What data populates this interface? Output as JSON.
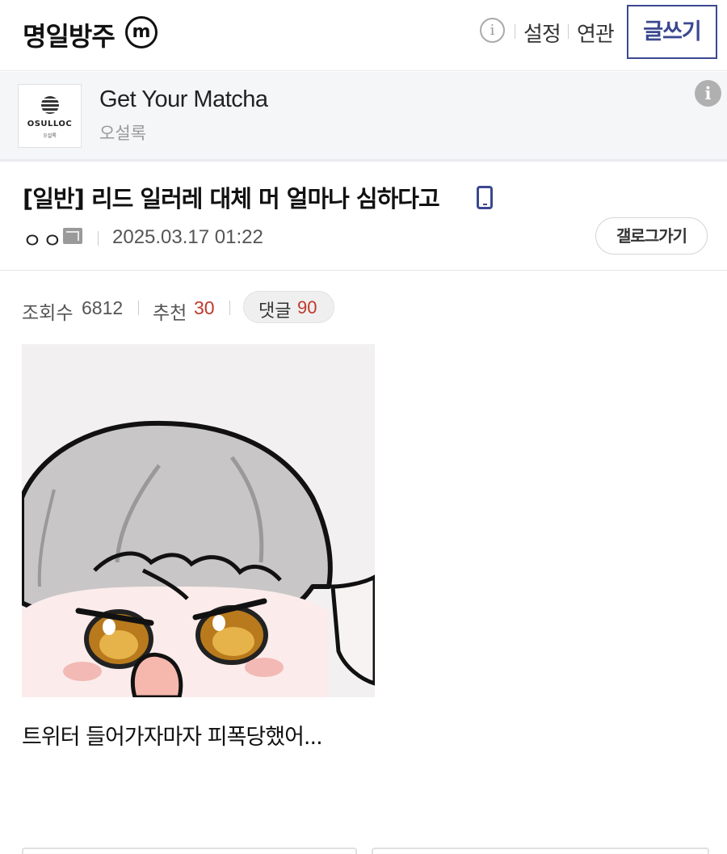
{
  "header": {
    "gallery_title": "명일방주",
    "minor_badge": "m",
    "info_icon": "i",
    "settings_label": "설정",
    "related_label": "연관",
    "write_label": "글쓰기"
  },
  "ad": {
    "logo_text": "OSULLOC",
    "logo_subtext": "오설록",
    "title": "Get Your Matcha",
    "brand": "오설록",
    "info_icon": "i"
  },
  "post": {
    "title": "[일반] 리드 일러레 대체 머 얼마나 심하다고",
    "author": "ㅇㅇ",
    "date": "2025.03.17 01:22",
    "gallog_label": "갤로그가기",
    "stats": {
      "views_label": "조회수",
      "views": "6812",
      "recommend_label": "추천",
      "recommend": "30",
      "comments_label": "댓글",
      "comments": "90"
    },
    "body_text": "트위터 들어가자마자 피폭당했어..."
  },
  "colors": {
    "accent": "#3b4890",
    "count_red": "#c0392b"
  },
  "icons": {
    "minor_gallery": "minor-gallery-icon",
    "info": "info-icon",
    "mobile": "mobile-icon",
    "fixed_nick": "fixed-nick-icon",
    "ad_info": "ad-info-icon"
  }
}
